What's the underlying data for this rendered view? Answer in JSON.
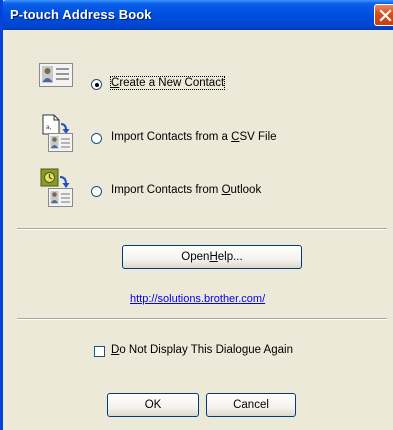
{
  "window": {
    "title": "P-touch Address Book"
  },
  "options": [
    {
      "label_pre": "",
      "label_u": "C",
      "label_post": "reate a New Contact",
      "checked": true,
      "icon": "contact-card-icon"
    },
    {
      "label_pre": "Import Contacts from a ",
      "label_u": "C",
      "label_post": "SV File",
      "checked": false,
      "icon": "csv-import-icon"
    },
    {
      "label_pre": "Import Contacts from ",
      "label_u": "O",
      "label_post": "utlook",
      "checked": false,
      "icon": "outlook-import-icon"
    }
  ],
  "help_button": {
    "label_pre": "Open ",
    "label_u": "H",
    "label_post": "elp..."
  },
  "link": {
    "text": "http://solutions.brother.com/"
  },
  "dont_display": {
    "label_pre": "",
    "label_u": "D",
    "label_post": "o Not Display This Dialogue Again",
    "checked": false
  },
  "buttons": {
    "ok": "OK",
    "cancel": "Cancel"
  },
  "colors": {
    "title_bar": "#0050e0",
    "dialog_bg": "#ece9d8",
    "link": "#0000ff",
    "close": "#d9501f"
  }
}
